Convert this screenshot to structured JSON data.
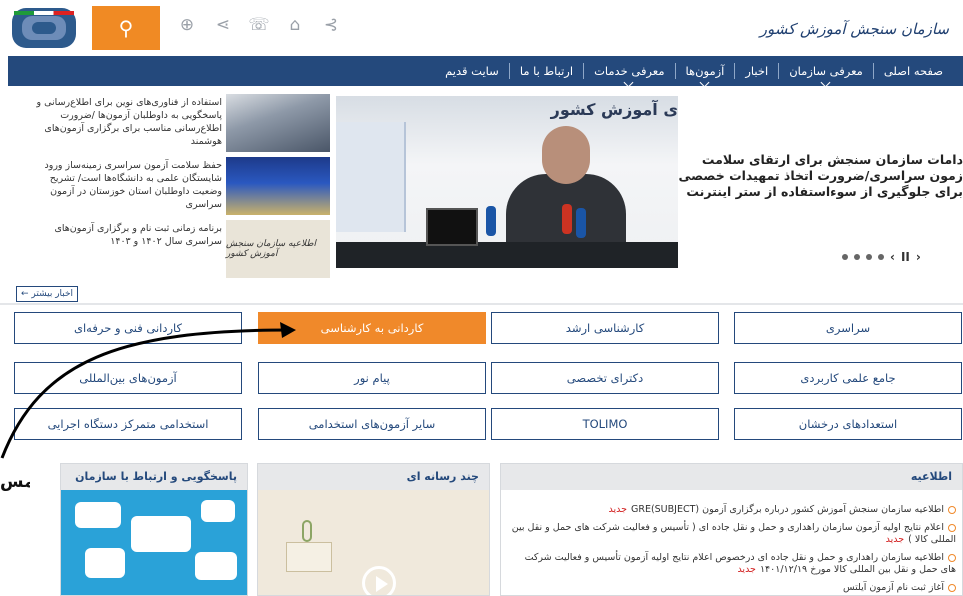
{
  "header": {
    "logo_text": "سازمان سنجش آموزش کشور",
    "search_icon": "search-icon",
    "icons": [
      "globe-icon",
      "share-icon",
      "phone-icon",
      "home-icon",
      "rss-icon"
    ],
    "icon_glyphs": [
      "⊕",
      "⋖",
      "☏",
      "⌂",
      "⊰"
    ],
    "search_glyph": "⚲"
  },
  "nav": {
    "items": [
      {
        "label": "صفحه اصلی",
        "caret": false
      },
      {
        "label": "معرفی سازمان",
        "caret": true
      },
      {
        "label": "اخبار",
        "caret": false
      },
      {
        "label": "آزمون‌ها",
        "caret": true
      },
      {
        "label": "معرفی خدمات",
        "caret": true
      },
      {
        "label": "ارتباط با ما",
        "caret": false
      },
      {
        "label": "سایت قدیم",
        "caret": false
      }
    ]
  },
  "news": {
    "side_items": [
      {
        "text": "استفاده از فناوری‌های نوین برای اطلاع‌رسانی و پاسخگویی به داوطلبان آزمون‌ها /ضرورت اطلاع‌رسانی مناسب برای برگزاری آزمون‌های هوشمند"
      },
      {
        "text": "حفظ سلامت آزمون سراسری زمینه‌ساز ورود شایستگان علمی به دانشگاه‌ها است/ تشریح وضعیت داوطلبان استان خوزستان در آزمون سراسری"
      },
      {
        "text": "برنامه زمانی ثبت نام و برگزاری آزمون‌های سراسری سال ۱۴۰۲ و ۱۴۰۳",
        "thumb_caption": "اطلاعیه سازمان سنجش آموزش کشور"
      }
    ],
    "main_banner": "ی آموزش کشور",
    "headline": "دامات سازمان سنجش برای ارتقای سلامت زمون سراسری/ضرورت اتخاذ تمهیدات خصصی برای جلوگیری از سوءاستفاده از ستر اینترنت",
    "slider_prev": "‹",
    "slider_pause": "II",
    "slider_next": "›",
    "more_label": "اخبار بیشتر ←"
  },
  "exams": [
    {
      "label": "سراسری",
      "active": false
    },
    {
      "label": "کارشناسی ارشد",
      "active": false
    },
    {
      "label": "کاردانی به کارشناسی",
      "active": true
    },
    {
      "label": "کاردانی فنی و حرفه‌ای",
      "active": false
    },
    {
      "label": "جامع علمی کاربردی",
      "active": false
    },
    {
      "label": "دکترای تخصصی",
      "active": false
    },
    {
      "label": "پیام نور",
      "active": false
    },
    {
      "label": "آزمون‌های بین‌المللی",
      "active": false
    },
    {
      "label": "استعدادهای درخشان",
      "active": false
    },
    {
      "label": "TOLIMO",
      "active": false
    },
    {
      "label": "سایر آزمون‌های استخدامی",
      "active": false
    },
    {
      "label": "استخدامی متمرکز دستگاه اجرایی",
      "active": false
    }
  ],
  "panels": {
    "announcements": {
      "title": "اطلاعیه",
      "new_label": "جدید",
      "items": [
        {
          "text": "اطلاعیه سازمان سنجش آموزش کشور درباره برگزاری آزمون (GRE(SUBJECT",
          "is_new": true
        },
        {
          "text": "اعلام نتایج اولیه آزمون سازمان راهداری و حمل و نقل جاده ای ( تأسیس و فعالیت شرکت های حمل و نقل بین المللی کالا )",
          "is_new": true
        },
        {
          "text": "اطلاعیه سازمان راهداری و حمل و نقل جاده ای درخصوص اعلام نتایج اولیه آزمون تأسیس و فعالیت شرکت های حمل و نقل بین المللی کالا مورخ ۱۴۰۱/۱۲/۱۹",
          "is_new": true
        },
        {
          "text": "آغاز ثبت نام آزمون آیلتس",
          "is_new": false
        }
      ]
    },
    "media": {
      "title": "چند رسانه ای"
    },
    "contact": {
      "title": "پاسخگویی و ارتباط با سازمان"
    }
  },
  "overlay": {
    "label": "مس"
  },
  "colors": {
    "nav_bg": "#24497c",
    "accent": "#f0892a",
    "new_badge": "#d21f1f"
  }
}
